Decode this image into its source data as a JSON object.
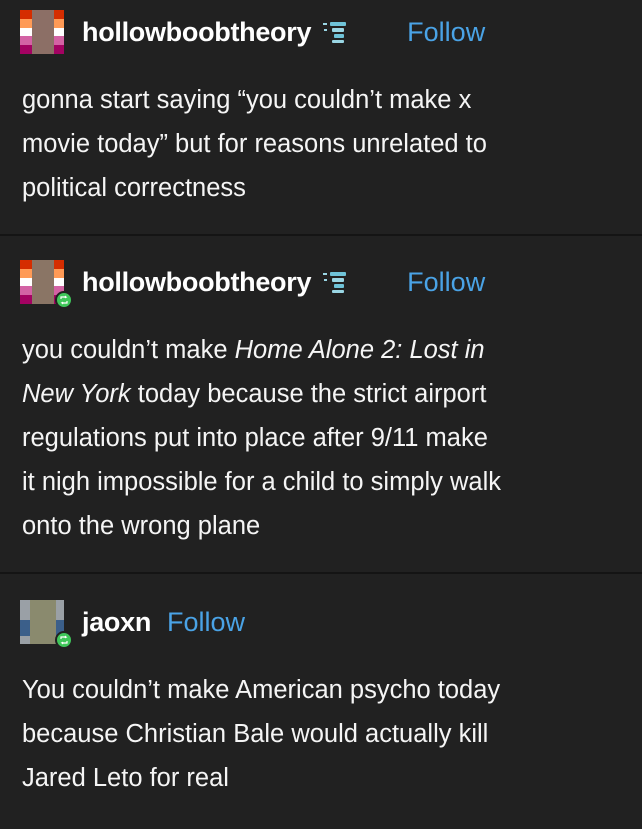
{
  "colors": {
    "background": "#212121",
    "text": "#f5f5f5",
    "follow": "#4aa3e6",
    "reblog_badge": "#3fc65a"
  },
  "posts": [
    {
      "username": "hollowboobtheory",
      "follow_label": "Follow",
      "badge_icon": "tumblr-badge-icon",
      "reblog": false,
      "text_lines": [
        "gonna start saying “you couldn’t make x",
        "movie today” but for reasons unrelated to",
        "political correctness"
      ]
    },
    {
      "username": "hollowboobtheory",
      "follow_label": "Follow",
      "badge_icon": "tumblr-badge-icon",
      "reblog": true,
      "text": {
        "prefix": "you couldn’t make ",
        "italic_title_1": "Home Alone 2: Lost in",
        "italic_title_2": "New York",
        "line2_rest": " today because the strict airport",
        "line3": "regulations put into place after 9/11 make",
        "line4": "it nigh impossible for a child to simply walk",
        "line5": "onto the wrong plane"
      }
    },
    {
      "username": "jaoxn",
      "follow_label": "Follow",
      "reblog": true,
      "text_lines": [
        "You couldn’t make American psycho today",
        "because Christian Bale would actually kill",
        "Jared Leto for real"
      ]
    }
  ]
}
